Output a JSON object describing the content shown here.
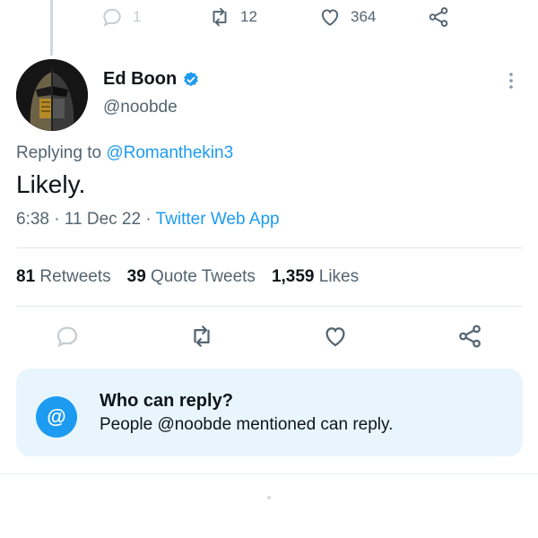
{
  "previous_tweet": {
    "replies": "1",
    "retweets": "12",
    "likes": "364"
  },
  "author": {
    "display_name": "Ed Boon",
    "handle": "@noobde",
    "verified": true
  },
  "tweet": {
    "replying_prefix": "Replying to ",
    "replying_to": "@Romanthekin3",
    "text": "Likely.",
    "time": "6:38 · 11 Dec 22 · ",
    "source": "Twitter Web App"
  },
  "stats": {
    "retweets_count": "81",
    "retweets_label": "Retweets",
    "quotes_count": "39",
    "quotes_label": "Quote Tweets",
    "likes_count": "1,359",
    "likes_label": "Likes"
  },
  "who_can_reply": {
    "icon": "@",
    "title": "Who can reply?",
    "subtitle": "People @noobde mentioned can reply."
  },
  "colors": {
    "accent": "#1d9bf0",
    "muted": "#536471",
    "box_bg": "#e8f5fd"
  }
}
